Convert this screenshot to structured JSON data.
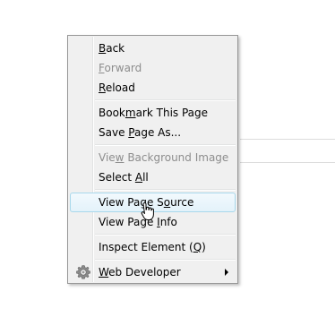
{
  "context_menu": {
    "items": [
      {
        "label": "Back",
        "state": "enabled",
        "underline": "B"
      },
      {
        "label": "Forward",
        "state": "disabled",
        "underline": "F"
      },
      {
        "label": "Reload",
        "state": "enabled",
        "underline": "R"
      },
      {
        "label": "Bookmark This Page",
        "state": "enabled",
        "underline": "m"
      },
      {
        "label": "Save Page As...",
        "state": "enabled",
        "underline": "P"
      },
      {
        "label": "View Background Image",
        "state": "disabled",
        "underline": "w"
      },
      {
        "label": "Select All",
        "state": "enabled",
        "underline": "A"
      },
      {
        "label": "View Page Source",
        "state": "highlighted",
        "underline": "o"
      },
      {
        "label": "View Page Info",
        "state": "enabled",
        "underline": "I"
      },
      {
        "label": "Inspect Element (Q)",
        "state": "enabled",
        "underline": "Q"
      },
      {
        "label": "Web Developer",
        "state": "enabled",
        "underline": "W",
        "icon": "gear-icon",
        "submenu": true
      }
    ]
  },
  "colors": {
    "menu_background": "#f0f0f0",
    "menu_border": "#979797",
    "highlight_border": "#a8d8eb",
    "highlight_fill": "#e3f2fa",
    "disabled_text": "#8d8d8d"
  }
}
